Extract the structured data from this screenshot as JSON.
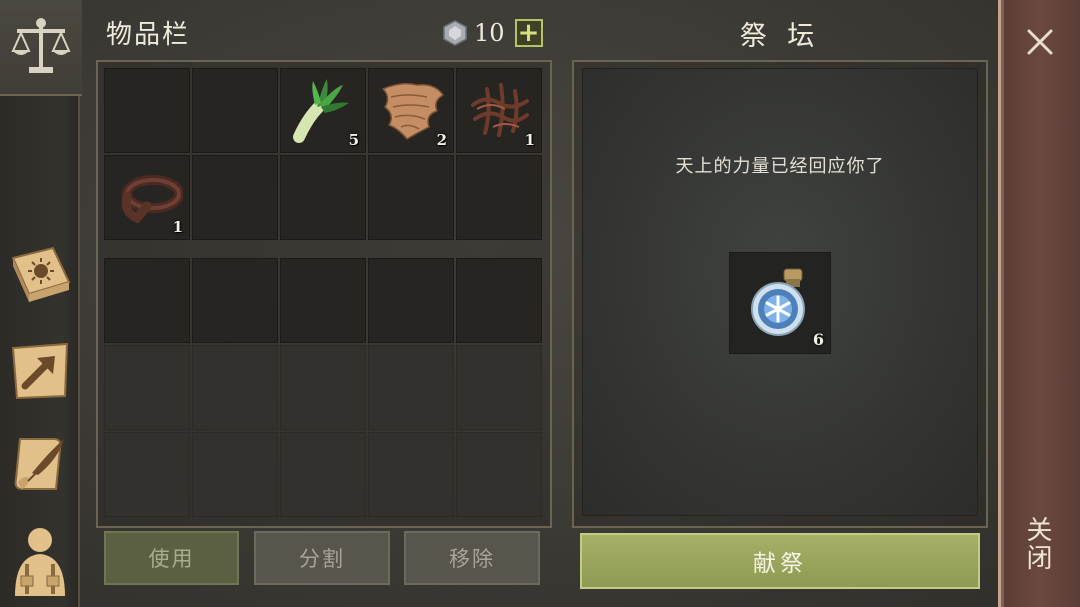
{
  "inventory": {
    "title": "物品栏",
    "currency": {
      "icon": "gem-icon",
      "value": "10"
    },
    "add_label": "+",
    "slots_top": [
      {
        "icon": "",
        "count": ""
      },
      {
        "icon": "",
        "count": ""
      },
      {
        "icon": "leek-icon",
        "count": "5"
      },
      {
        "icon": "cloth-scrap-icon",
        "count": "2"
      },
      {
        "icon": "fiber-bundle-icon",
        "count": "1"
      },
      {
        "icon": "leather-strap-icon",
        "count": "1"
      },
      {
        "icon": "",
        "count": ""
      },
      {
        "icon": "",
        "count": ""
      },
      {
        "icon": "",
        "count": ""
      },
      {
        "icon": "",
        "count": ""
      }
    ],
    "buttons": {
      "use": "使用",
      "split": "分割",
      "remove": "移除"
    }
  },
  "altar": {
    "title": "祭 坛",
    "message": "天上的力量已经回应你了",
    "offering": {
      "icon": "frost-potion-icon",
      "count": "6"
    },
    "offer_label": "献祭"
  },
  "close": {
    "label": "关闭"
  },
  "sidebar": {
    "tabs": [
      {
        "icon": "balance-scale-icon",
        "active": true
      },
      {
        "icon": "sun-book-icon",
        "active": false
      },
      {
        "icon": "arrow-map-icon",
        "active": false
      },
      {
        "icon": "quill-scroll-icon",
        "active": false
      },
      {
        "icon": "character-icon",
        "active": false
      }
    ]
  },
  "colors": {
    "accent": "#a6b066",
    "close_bg": "#6b4840",
    "panel_border": "#6b6452"
  }
}
